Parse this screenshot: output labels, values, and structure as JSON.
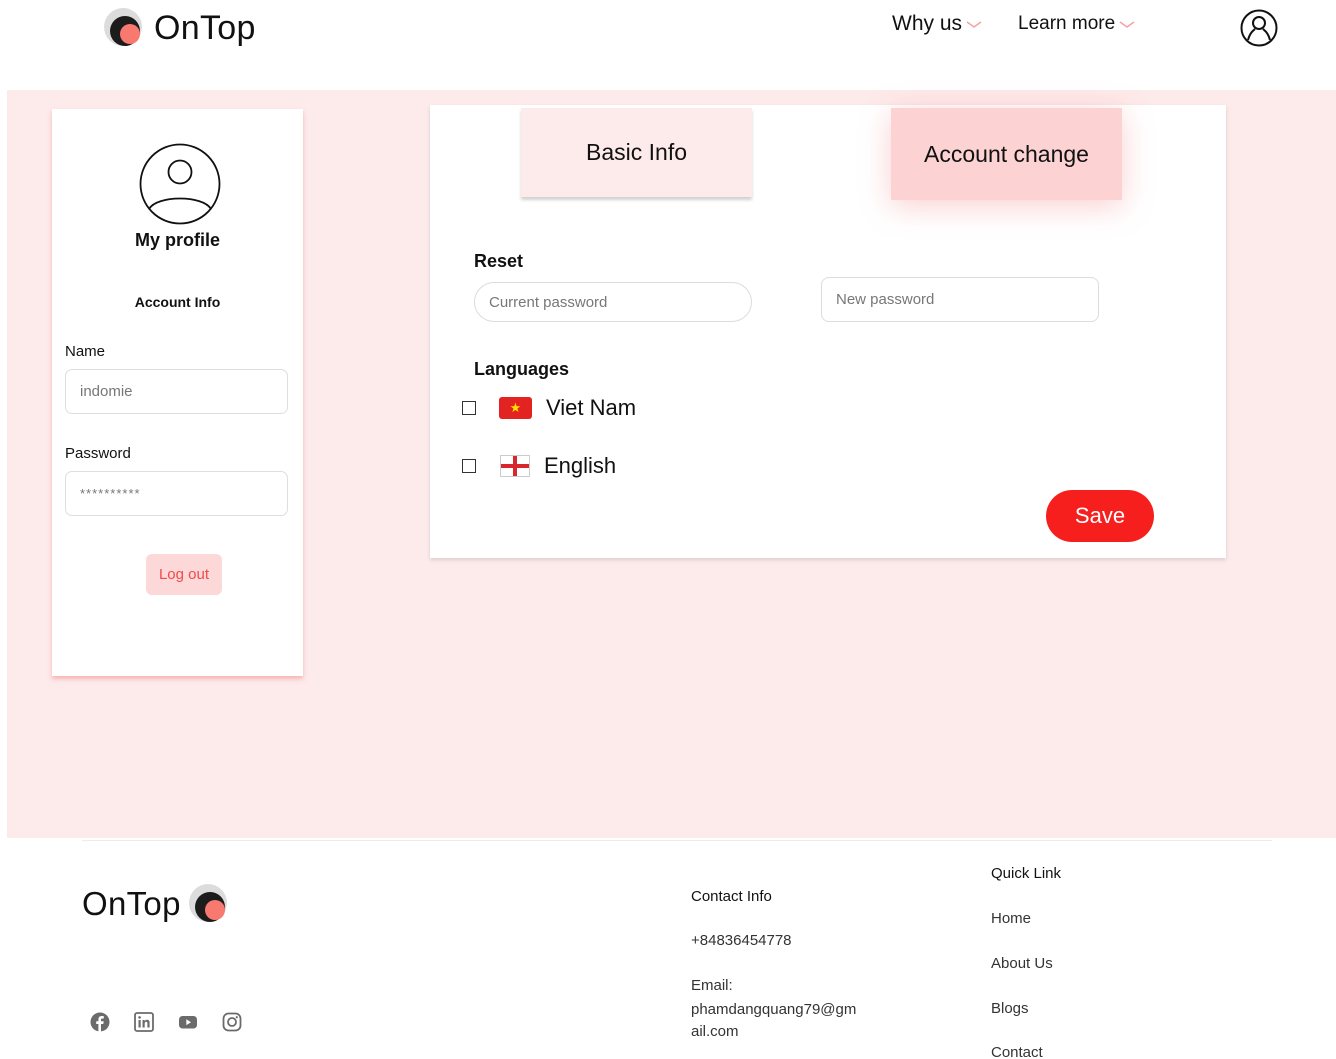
{
  "header": {
    "brand": "OnTop",
    "nav": [
      {
        "label": "Why us"
      },
      {
        "label": "Learn more"
      }
    ]
  },
  "profile_card": {
    "title": "My profile",
    "section": "Account Info",
    "name_label": "Name",
    "name_value": "indomie",
    "password_label": "Password",
    "password_value": "**********",
    "logout_label": "Log out"
  },
  "panel": {
    "tabs": [
      {
        "label": "Basic Info"
      },
      {
        "label": "Account change"
      }
    ],
    "reset_title": "Reset",
    "current_password_placeholder": "Current password",
    "new_password_placeholder": "New password",
    "languages_title": "Languages",
    "languages": [
      {
        "label": "Viet Nam",
        "checked": false
      },
      {
        "label": "English",
        "checked": false
      }
    ],
    "save_label": "Save"
  },
  "footer": {
    "brand": "OnTop",
    "contact_title": "Contact Info",
    "phone": "+84836454778",
    "email_label": "Email:",
    "email": "phamdangquang79@gmail.com",
    "quick_title": "Quick Link",
    "links": [
      "Home",
      "About Us",
      "Blogs",
      "Contact"
    ],
    "socials": [
      "facebook-icon",
      "linkedin-icon",
      "youtube-icon",
      "instagram-icon"
    ]
  },
  "colors": {
    "band": "#fdeaea",
    "accent": "#f71e1e",
    "tab_active": "#fcd2d2",
    "logout_bg": "#fcd8d8"
  }
}
